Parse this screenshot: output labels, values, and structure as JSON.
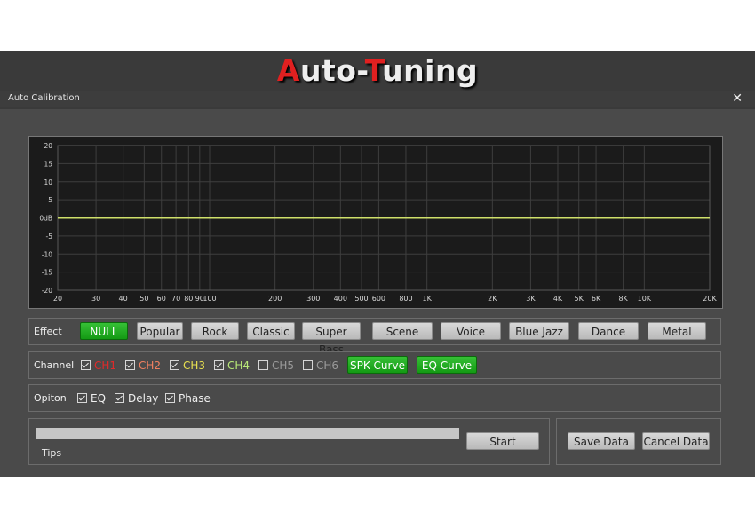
{
  "banner": {
    "title_prefix": "A",
    "title_mid": "uto-",
    "title_t": "T",
    "title_suffix": "uning"
  },
  "window": {
    "title": "Auto Calibration",
    "close_glyph": "✕"
  },
  "chart_data": {
    "type": "line",
    "x_scale": "log",
    "xlim": [
      20,
      20000
    ],
    "ylim": [
      -20,
      20
    ],
    "x_ticks": [
      20,
      30,
      40,
      50,
      60,
      70,
      80,
      90,
      100,
      200,
      300,
      400,
      500,
      600,
      800,
      1000,
      2000,
      3000,
      4000,
      5000,
      6000,
      8000,
      10000,
      20000
    ],
    "x_tick_labels": [
      "20",
      "30",
      "40",
      "50",
      "60",
      "70",
      "80",
      "90",
      "100",
      "200",
      "300",
      "400",
      "500",
      "600",
      "800",
      "1K",
      "2K",
      "3K",
      "4K",
      "5K",
      "6K",
      "8K",
      "10K",
      "20K"
    ],
    "y_ticks": [
      20,
      15,
      10,
      5,
      0,
      -5,
      -10,
      -15,
      -20
    ],
    "y_tick_labels": [
      "20",
      "15",
      "10",
      "5",
      "0dB",
      "-5",
      "-10",
      "-15",
      "-20"
    ],
    "grid": true,
    "series": [
      {
        "color": "#cfe06a",
        "x": [
          20,
          20000
        ],
        "y": [
          0,
          0
        ]
      }
    ]
  },
  "effect": {
    "label": "Effect",
    "buttons": [
      "NULL",
      "Popular",
      "Rock",
      "Classic",
      "Super Bass",
      "Scene",
      "Voice",
      "Blue Jazz",
      "Dance",
      "Metal"
    ],
    "selected": "NULL"
  },
  "channel": {
    "label": "Channel",
    "items": [
      {
        "label": "CH1",
        "checked": true,
        "color": "#e02a2a"
      },
      {
        "label": "CH2",
        "checked": true,
        "color": "#f08060"
      },
      {
        "label": "CH3",
        "checked": true,
        "color": "#e8e050"
      },
      {
        "label": "CH4",
        "checked": true,
        "color": "#b8e878"
      },
      {
        "label": "CH5",
        "checked": false,
        "color": "#9a9a9a"
      },
      {
        "label": "CH6",
        "checked": false,
        "color": "#9a9a9a"
      }
    ],
    "spk_curve": "SPK Curve",
    "eq_curve": "EQ Curve"
  },
  "option": {
    "label": "Opiton",
    "items": [
      {
        "label": "EQ",
        "checked": true
      },
      {
        "label": "Delay",
        "checked": true
      },
      {
        "label": "Phase",
        "checked": true
      }
    ]
  },
  "progress": {
    "value": 0,
    "tips_label": "Tips",
    "start_label": "Start"
  },
  "data_buttons": {
    "save": "Save Data",
    "cancel": "Cancel Data"
  }
}
